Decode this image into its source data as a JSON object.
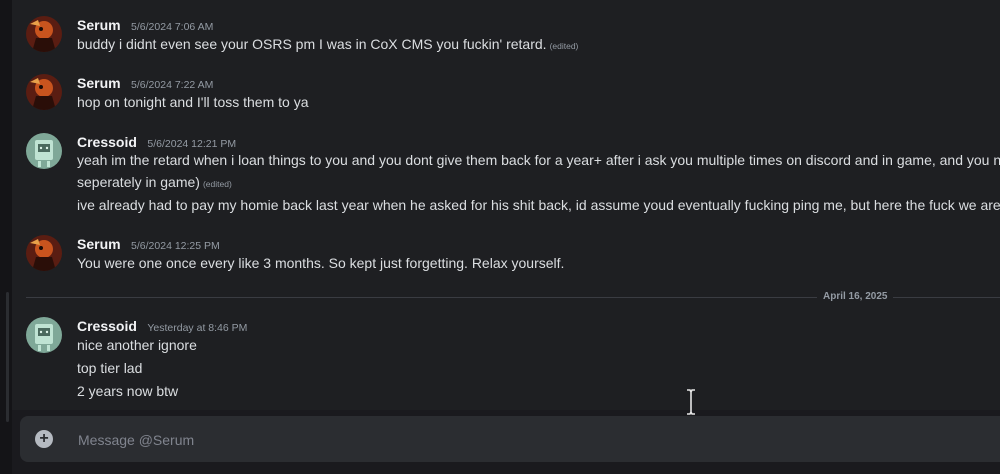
{
  "messages": [
    {
      "author": "Serum",
      "timestamp": "5/6/2024 7:06 AM",
      "avatar": "serum-avatar",
      "lines": [
        {
          "text": "buddy i didnt even see your OSRS pm I was in CoX CMS you fuckin' retard.",
          "edited": "(edited)"
        }
      ]
    },
    {
      "author": "Serum",
      "timestamp": "5/6/2024 7:22 AM",
      "avatar": "serum-avatar",
      "lines": [
        {
          "text": "hop on tonight and I'll toss them to ya"
        }
      ]
    },
    {
      "author": "Cressoid",
      "timestamp": "5/6/2024 12:21 PM",
      "avatar": "cressoid-avatar",
      "lines": [
        {
          "text": "yeah im the retard when i loan things to you and you dont give them back for a year+ after i ask you multiple times on discord and in game, and you neve"
        },
        {
          "text": "seperately in game)",
          "edited": "(edited)"
        },
        {
          "text": "ive already had to pay my homie back last year when he asked for his shit back, id assume youd eventually fucking ping me, but here the fuck we are are"
        }
      ]
    },
    {
      "author": "Serum",
      "timestamp": "5/6/2024 12:25 PM",
      "avatar": "serum-avatar",
      "lines": [
        {
          "text": "You were one once every like 3 months. So kept just forgetting. Relax yourself."
        }
      ]
    },
    {
      "author": "Cressoid",
      "timestamp": "Yesterday at 8:46 PM",
      "avatar": "cressoid-avatar",
      "lines": [
        {
          "text": "nice another ignore"
        },
        {
          "text": "top tier lad"
        },
        {
          "text": "2 years now btw"
        }
      ]
    }
  ],
  "date_divider": "April 16, 2025",
  "composer": {
    "placeholder": "Message @Serum",
    "value": "",
    "attach_icon": "plus-circle-icon"
  },
  "colors": {
    "background": "#1e1f22",
    "composer": "#2b2d31",
    "author": "#f2f3f5",
    "timestamp": "#949ba4",
    "text": "#dbdee1"
  }
}
